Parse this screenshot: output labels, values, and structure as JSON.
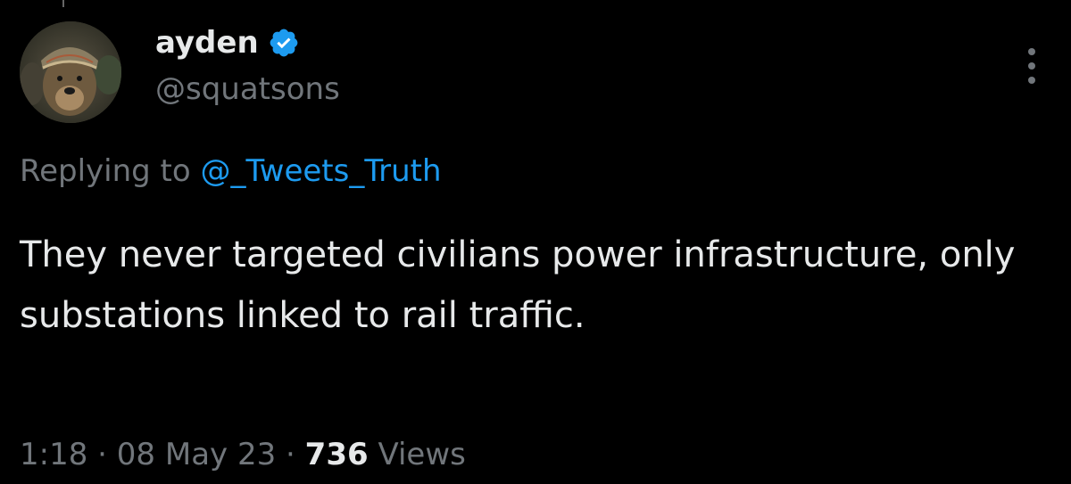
{
  "tweet": {
    "author": {
      "display_name": "ayden",
      "handle": "@squatsons",
      "verified": true
    },
    "reply": {
      "prefix": "Replying to ",
      "mention": "@_Tweets_Truth"
    },
    "text": "They never targeted civilians power infrastructure, only substations linked to rail traffic.",
    "meta": {
      "time": "1:18",
      "separator": " · ",
      "date": "08 May 23",
      "views_count": "736",
      "views_label": " Views"
    }
  },
  "icons": {
    "verified": "verified-badge-icon",
    "more": "more-options-icon"
  },
  "colors": {
    "background": "#000000",
    "primary_text": "#e7e9ea",
    "secondary_text": "#71767b",
    "accent": "#1d9bf0"
  }
}
